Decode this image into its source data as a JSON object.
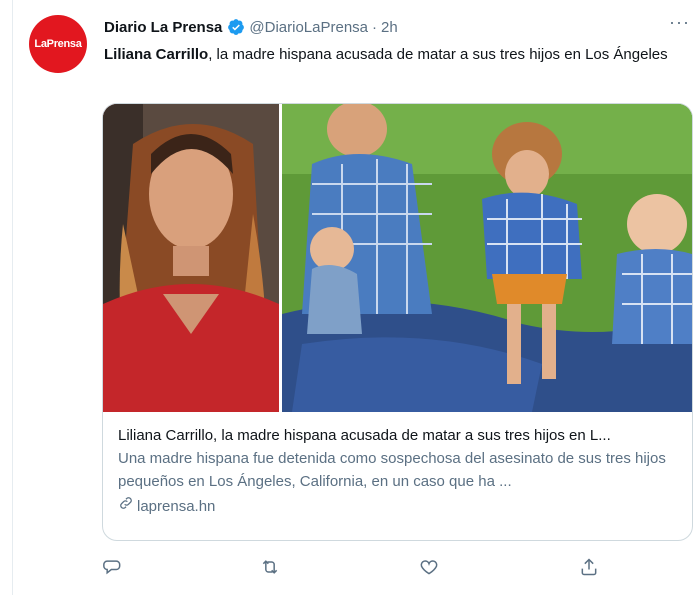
{
  "account": {
    "display_name": "Diario La Prensa",
    "handle": "@DiarioLaPrensa",
    "separator": "·",
    "time": "2h",
    "avatar_text": "LaPrensa",
    "brand_color": "#e2171f",
    "verified_color": "#1d9bf0"
  },
  "tweet": {
    "bold_lead": "Liliana Carrillo",
    "rest": ", la madre hispana acusada de matar a sus tres hijos en Los Ángeles"
  },
  "menu": {
    "more_label": "···"
  },
  "card": {
    "title": "Liliana Carrillo, la madre hispana acusada de matar a sus tres hijos en L...",
    "description": "Una madre hispana fue detenida como sospechosa del asesinato de sus tres hijos pequeños en Los Ángeles, California, en un caso que ha ...",
    "domain": "laprensa.hn"
  },
  "actions": {
    "icons": [
      "reply-icon",
      "retweet-icon",
      "like-icon",
      "share-icon"
    ],
    "icon_color": "#5b7083"
  }
}
